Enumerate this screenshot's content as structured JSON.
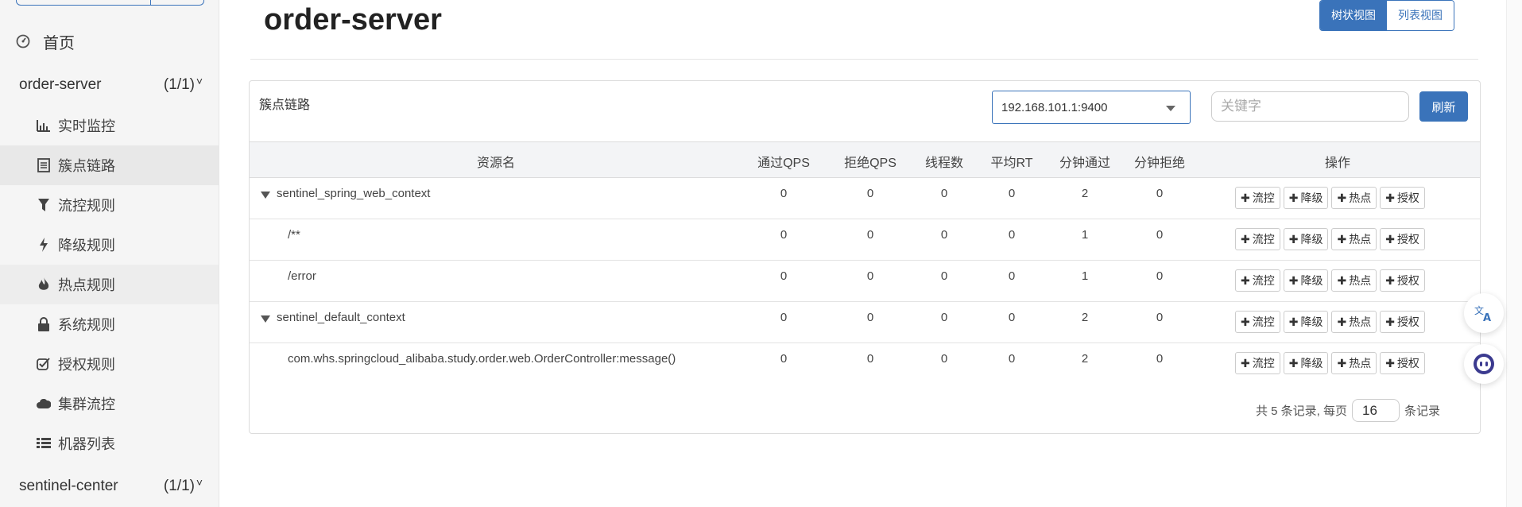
{
  "sidebar": {
    "home_label": "首页",
    "apps": [
      {
        "name": "order-server",
        "count": "(1/1)"
      },
      {
        "name": "sentinel-center",
        "count": "(1/1)"
      }
    ],
    "menu": [
      {
        "label": "实时监控",
        "icon": "bar-chart-icon"
      },
      {
        "label": "簇点链路",
        "icon": "list-icon"
      },
      {
        "label": "流控规则",
        "icon": "filter-icon"
      },
      {
        "label": "降级规则",
        "icon": "flash-icon"
      },
      {
        "label": "热点规则",
        "icon": "fire-icon"
      },
      {
        "label": "系统规则",
        "icon": "lock-icon"
      },
      {
        "label": "授权规则",
        "icon": "check-icon"
      },
      {
        "label": "集群流控",
        "icon": "cloud-icon"
      },
      {
        "label": "机器列表",
        "icon": "th-list-icon"
      }
    ]
  },
  "header": {
    "title": "order-server",
    "view_tree": "树状视图",
    "view_list": "列表视图"
  },
  "panel": {
    "title": "簇点链路",
    "machine": "192.168.101.1:9400",
    "keyword_placeholder": "关键字",
    "refresh": "刷新"
  },
  "table": {
    "headers": [
      "资源名",
      "通过QPS",
      "拒绝QPS",
      "线程数",
      "平均RT",
      "分钟通过",
      "分钟拒绝",
      "操作"
    ],
    "rows": [
      {
        "name": "sentinel_spring_web_context",
        "values": [
          "0",
          "0",
          "0",
          "0",
          "2",
          "0"
        ]
      },
      {
        "name": "/**",
        "values": [
          "0",
          "0",
          "0",
          "0",
          "1",
          "0"
        ]
      },
      {
        "name": "/error",
        "values": [
          "0",
          "0",
          "0",
          "0",
          "1",
          "0"
        ]
      },
      {
        "name": "sentinel_default_context",
        "values": [
          "0",
          "0",
          "0",
          "0",
          "2",
          "0"
        ]
      },
      {
        "name": "com.whs.springcloud_alibaba.study.order.web.OrderController:message()",
        "values": [
          "0",
          "0",
          "0",
          "0",
          "2",
          "0"
        ]
      }
    ],
    "actions": {
      "plus": "✚",
      "flow": "流控",
      "degrade": "降级",
      "hot": "热点",
      "auth": "授权"
    }
  },
  "pager": {
    "total_text": "共 5 条记录, 每页",
    "page_size": "16",
    "suffix": "条记录"
  },
  "colors": {
    "accent": "#3a73ba",
    "sidebar_bg": "#f5f5f5"
  }
}
